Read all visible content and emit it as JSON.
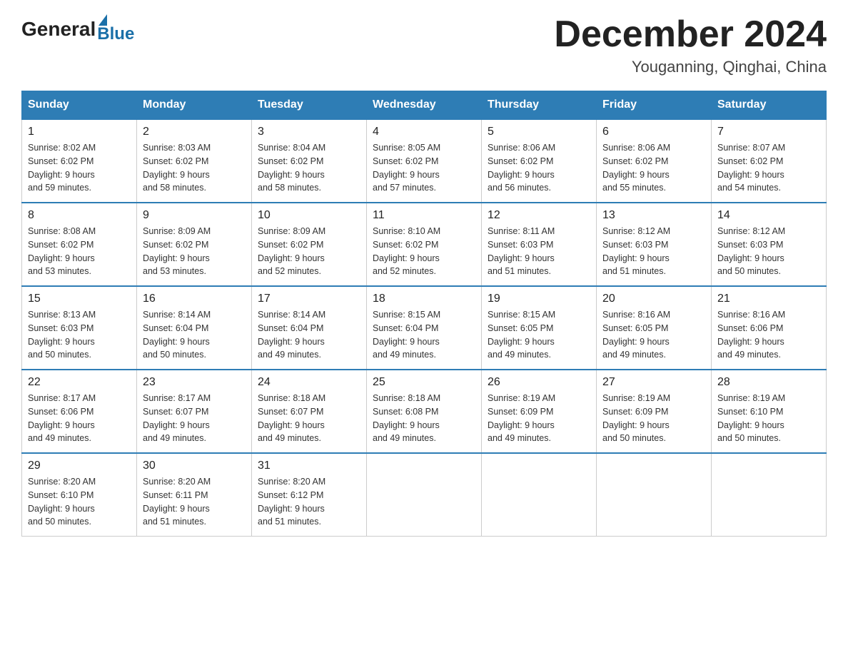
{
  "logo": {
    "general": "General",
    "blue": "Blue"
  },
  "title": {
    "month_year": "December 2024",
    "location": "Youganning, Qinghai, China"
  },
  "headers": [
    "Sunday",
    "Monday",
    "Tuesday",
    "Wednesday",
    "Thursday",
    "Friday",
    "Saturday"
  ],
  "weeks": [
    [
      {
        "day": "1",
        "info": "Sunrise: 8:02 AM\nSunset: 6:02 PM\nDaylight: 9 hours\nand 59 minutes."
      },
      {
        "day": "2",
        "info": "Sunrise: 8:03 AM\nSunset: 6:02 PM\nDaylight: 9 hours\nand 58 minutes."
      },
      {
        "day": "3",
        "info": "Sunrise: 8:04 AM\nSunset: 6:02 PM\nDaylight: 9 hours\nand 58 minutes."
      },
      {
        "day": "4",
        "info": "Sunrise: 8:05 AM\nSunset: 6:02 PM\nDaylight: 9 hours\nand 57 minutes."
      },
      {
        "day": "5",
        "info": "Sunrise: 8:06 AM\nSunset: 6:02 PM\nDaylight: 9 hours\nand 56 minutes."
      },
      {
        "day": "6",
        "info": "Sunrise: 8:06 AM\nSunset: 6:02 PM\nDaylight: 9 hours\nand 55 minutes."
      },
      {
        "day": "7",
        "info": "Sunrise: 8:07 AM\nSunset: 6:02 PM\nDaylight: 9 hours\nand 54 minutes."
      }
    ],
    [
      {
        "day": "8",
        "info": "Sunrise: 8:08 AM\nSunset: 6:02 PM\nDaylight: 9 hours\nand 53 minutes."
      },
      {
        "day": "9",
        "info": "Sunrise: 8:09 AM\nSunset: 6:02 PM\nDaylight: 9 hours\nand 53 minutes."
      },
      {
        "day": "10",
        "info": "Sunrise: 8:09 AM\nSunset: 6:02 PM\nDaylight: 9 hours\nand 52 minutes."
      },
      {
        "day": "11",
        "info": "Sunrise: 8:10 AM\nSunset: 6:02 PM\nDaylight: 9 hours\nand 52 minutes."
      },
      {
        "day": "12",
        "info": "Sunrise: 8:11 AM\nSunset: 6:03 PM\nDaylight: 9 hours\nand 51 minutes."
      },
      {
        "day": "13",
        "info": "Sunrise: 8:12 AM\nSunset: 6:03 PM\nDaylight: 9 hours\nand 51 minutes."
      },
      {
        "day": "14",
        "info": "Sunrise: 8:12 AM\nSunset: 6:03 PM\nDaylight: 9 hours\nand 50 minutes."
      }
    ],
    [
      {
        "day": "15",
        "info": "Sunrise: 8:13 AM\nSunset: 6:03 PM\nDaylight: 9 hours\nand 50 minutes."
      },
      {
        "day": "16",
        "info": "Sunrise: 8:14 AM\nSunset: 6:04 PM\nDaylight: 9 hours\nand 50 minutes."
      },
      {
        "day": "17",
        "info": "Sunrise: 8:14 AM\nSunset: 6:04 PM\nDaylight: 9 hours\nand 49 minutes."
      },
      {
        "day": "18",
        "info": "Sunrise: 8:15 AM\nSunset: 6:04 PM\nDaylight: 9 hours\nand 49 minutes."
      },
      {
        "day": "19",
        "info": "Sunrise: 8:15 AM\nSunset: 6:05 PM\nDaylight: 9 hours\nand 49 minutes."
      },
      {
        "day": "20",
        "info": "Sunrise: 8:16 AM\nSunset: 6:05 PM\nDaylight: 9 hours\nand 49 minutes."
      },
      {
        "day": "21",
        "info": "Sunrise: 8:16 AM\nSunset: 6:06 PM\nDaylight: 9 hours\nand 49 minutes."
      }
    ],
    [
      {
        "day": "22",
        "info": "Sunrise: 8:17 AM\nSunset: 6:06 PM\nDaylight: 9 hours\nand 49 minutes."
      },
      {
        "day": "23",
        "info": "Sunrise: 8:17 AM\nSunset: 6:07 PM\nDaylight: 9 hours\nand 49 minutes."
      },
      {
        "day": "24",
        "info": "Sunrise: 8:18 AM\nSunset: 6:07 PM\nDaylight: 9 hours\nand 49 minutes."
      },
      {
        "day": "25",
        "info": "Sunrise: 8:18 AM\nSunset: 6:08 PM\nDaylight: 9 hours\nand 49 minutes."
      },
      {
        "day": "26",
        "info": "Sunrise: 8:19 AM\nSunset: 6:09 PM\nDaylight: 9 hours\nand 49 minutes."
      },
      {
        "day": "27",
        "info": "Sunrise: 8:19 AM\nSunset: 6:09 PM\nDaylight: 9 hours\nand 50 minutes."
      },
      {
        "day": "28",
        "info": "Sunrise: 8:19 AM\nSunset: 6:10 PM\nDaylight: 9 hours\nand 50 minutes."
      }
    ],
    [
      {
        "day": "29",
        "info": "Sunrise: 8:20 AM\nSunset: 6:10 PM\nDaylight: 9 hours\nand 50 minutes."
      },
      {
        "day": "30",
        "info": "Sunrise: 8:20 AM\nSunset: 6:11 PM\nDaylight: 9 hours\nand 51 minutes."
      },
      {
        "day": "31",
        "info": "Sunrise: 8:20 AM\nSunset: 6:12 PM\nDaylight: 9 hours\nand 51 minutes."
      },
      null,
      null,
      null,
      null
    ]
  ]
}
